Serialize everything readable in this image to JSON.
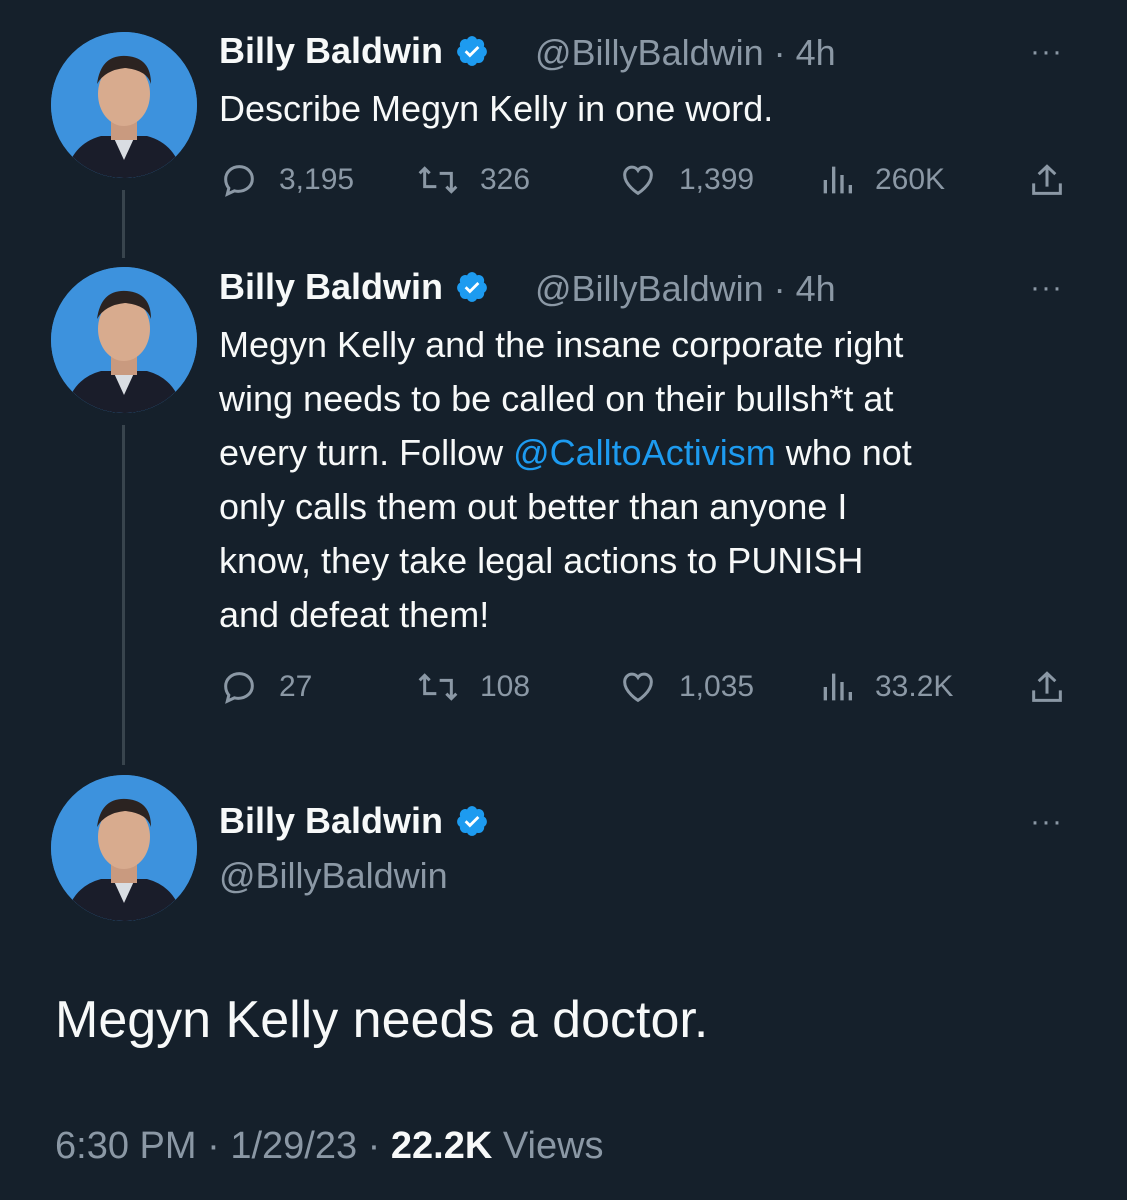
{
  "tweet1": {
    "name": "Billy Baldwin",
    "handle": "@BillyBaldwin",
    "time": "· 4h",
    "text": "Describe Megyn Kelly in one word.",
    "replies": "3,195",
    "retweets": "326",
    "likes": "1,399",
    "views": "260K"
  },
  "tweet2": {
    "name": "Billy Baldwin",
    "handle": "@BillyBaldwin",
    "time": "· 4h",
    "text_lines": [
      "Megyn Kelly and the insane corporate right",
      "wing needs to be called on their bullsh*t at",
      "every turn. Follow ",
      " who not",
      "only calls them out better than anyone I",
      "know, they take legal actions to PUNISH",
      "and defeat them!"
    ],
    "mention": "@CalltoActivism",
    "replies": "27",
    "retweets": "108",
    "likes": "1,035",
    "views": "33.2K"
  },
  "tweet3": {
    "name": "Billy Baldwin",
    "handle": "@BillyBaldwin",
    "text": "Megyn Kelly needs a doctor.",
    "time": "6:30 PM",
    "date": "1/29/23",
    "views_count": "22.2K",
    "views_label": "Views"
  },
  "more_label": "···",
  "colors": {
    "background": "#15202b",
    "text": "#f7f9f9",
    "secondary": "#8b98a5",
    "accent": "#1d9bf0"
  },
  "icons": [
    "verified-badge-icon",
    "reply-icon",
    "retweet-icon",
    "like-icon",
    "views-icon",
    "share-icon",
    "more-icon"
  ]
}
